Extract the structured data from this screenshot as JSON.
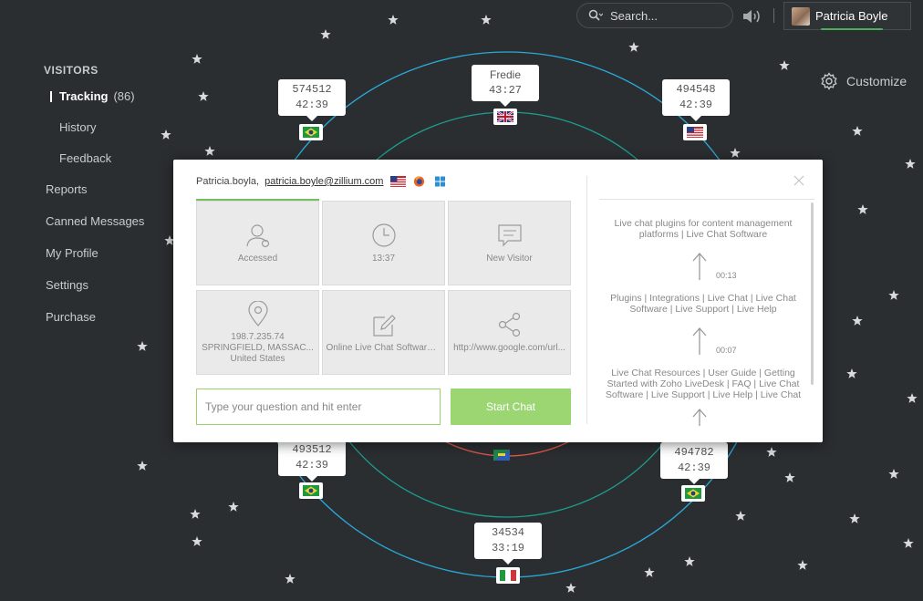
{
  "search": {
    "placeholder": "Search..."
  },
  "user": {
    "name": "Patricia Boyle"
  },
  "sidebar": {
    "section": "VISITORS",
    "sub_items": [
      {
        "label": "Tracking",
        "count": "(86)",
        "active": true
      },
      {
        "label": "History"
      },
      {
        "label": "Feedback"
      }
    ],
    "items": [
      "Reports",
      "Canned Messages",
      "My Profile",
      "Settings",
      "Purchase"
    ]
  },
  "customize": {
    "label": "Customize"
  },
  "visitors": [
    {
      "id": "574512",
      "time": "42:39",
      "flag": "br"
    },
    {
      "id": "Fredie",
      "time": "43:27",
      "flag": "gb"
    },
    {
      "id": "494548",
      "time": "42:39",
      "flag": "us"
    },
    {
      "id": "493512",
      "time": "42:39",
      "flag": "br"
    },
    {
      "id": "494782",
      "time": "42:39",
      "flag": "br"
    },
    {
      "id": "34534",
      "time": "33:19",
      "flag": "it"
    }
  ],
  "modal": {
    "name": "Patricia.boyla,",
    "email": "patricia.boyle@zillium.com",
    "env_icons": [
      "us-flag-icon",
      "firefox-icon",
      "windows-icon"
    ],
    "tiles": [
      {
        "icon": "user-icon",
        "lines": [
          "Accessed"
        ]
      },
      {
        "icon": "clock-icon",
        "lines": [
          "13:37"
        ]
      },
      {
        "icon": "chat-icon",
        "lines": [
          "New Visitor"
        ]
      },
      {
        "icon": "location-pin-icon",
        "lines": [
          "198.7.235.74",
          "SPRINGFIELD, MASSAC...",
          "United States"
        ]
      },
      {
        "icon": "edit-icon",
        "lines": [
          "Online Live Chat Software ..."
        ]
      },
      {
        "icon": "share-icon",
        "lines": [
          "http://www.google.com/url..."
        ]
      }
    ],
    "input_placeholder": "Type your question and hit enter",
    "start_label": "Start Chat",
    "trail": [
      "Live chat plugins for content management platforms | Live Chat Software",
      "00:13",
      "Plugins | Integrations | Live Chat | Live Chat Software | Live Support | Live Help",
      "00:07",
      "Live Chat Resources | User Guide | Getting Started with Zoho LiveDesk | FAQ | Live Chat Software | Live Support | Live Help | Live Chat"
    ]
  }
}
